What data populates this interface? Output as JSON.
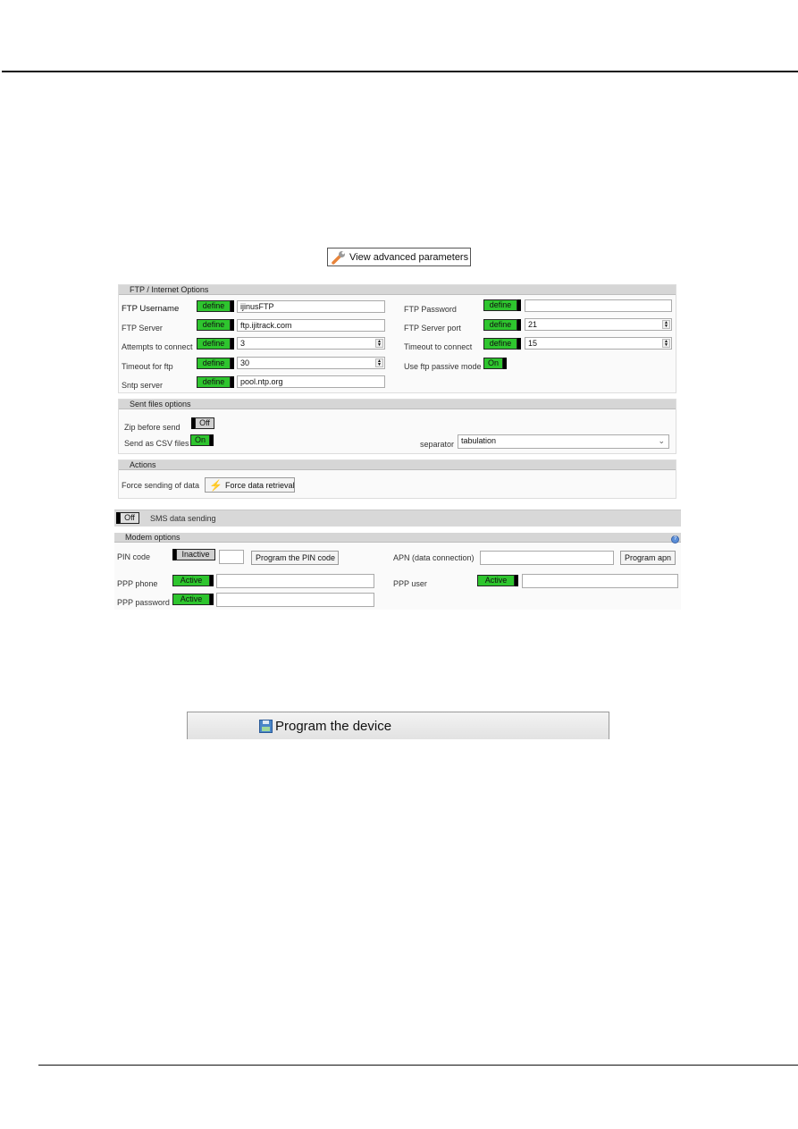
{
  "advanced_button": {
    "label": "View advanced parameters",
    "icon": "wrench-icon"
  },
  "ftp_section": {
    "title": "FTP / Internet Options",
    "left": [
      {
        "label": "FTP Username",
        "toggle": "define",
        "value": "ijinusFTP",
        "spinner": false
      },
      {
        "label": "FTP Server",
        "toggle": "define",
        "value": "ftp.ijitrack.com",
        "spinner": false
      },
      {
        "label": "Attempts to connect",
        "toggle": "define",
        "value": "3",
        "spinner": true
      },
      {
        "label": "Timeout for ftp",
        "toggle": "define",
        "value": "30",
        "spinner": true
      },
      {
        "label": "Sntp server",
        "toggle": "define",
        "value": "pool.ntp.org",
        "spinner": false
      }
    ],
    "right": [
      {
        "label": "FTP Password",
        "toggle": "define",
        "value": "",
        "spinner": false
      },
      {
        "label": "FTP Server port",
        "toggle": "define",
        "value": "21",
        "spinner": true
      },
      {
        "label": "Timeout to connect",
        "toggle": "define",
        "value": "15",
        "spinner": true
      }
    ],
    "passive_mode": {
      "label": "Use ftp passive mode",
      "state": "On"
    }
  },
  "sent_files": {
    "title": "Sent files options",
    "zip": {
      "label": "Zip before send",
      "state": "Off"
    },
    "csv": {
      "label": "Send as CSV files",
      "state": "On"
    },
    "separator": {
      "label": "separator",
      "selected": "tabulation"
    }
  },
  "actions": {
    "title": "Actions",
    "force_label": "Force sending of data",
    "force_button": "Force data retrieval",
    "force_icon": "lightning-icon"
  },
  "sms": {
    "state": "Off",
    "label": "SMS data sending"
  },
  "modem": {
    "title": "Modem options",
    "pin": {
      "label": "PIN code",
      "state": "Inactive",
      "value": "",
      "button": "Program the PIN code"
    },
    "apn": {
      "label": "APN (data connection)",
      "value": "",
      "button": "Program apn"
    },
    "ppp_phone": {
      "label": "PPP phone",
      "state": "Active",
      "value": ""
    },
    "ppp_user": {
      "label": "PPP user",
      "state": "Active",
      "value": ""
    },
    "ppp_password": {
      "label": "PPP password",
      "state": "Active",
      "value": ""
    }
  },
  "program_button": {
    "label": "Program the device",
    "icon": "floppy-disk-icon"
  }
}
